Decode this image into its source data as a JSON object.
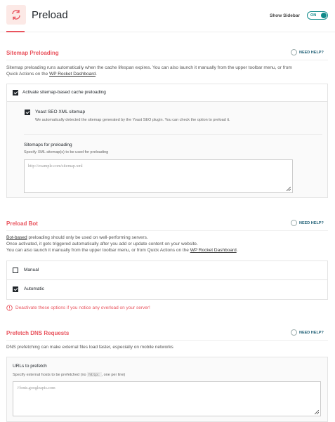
{
  "header": {
    "title": "Preload",
    "show_sidebar_label": "Show Sidebar",
    "toggle_state": "ON"
  },
  "sitemap": {
    "title": "Sitemap Preloading",
    "need_help": "NEED HELP?",
    "desc1": "Sitemap preloading runs automatically when the cache lifespan expires. You can also launch it manually from the upper toolbar menu, or from",
    "desc2_pre": "Quick Actions on the ",
    "desc2_link": "WP Rocket Dashboard",
    "desc2_post": ".",
    "activate_label": "Activate sitemap-based cache preloading",
    "yoast_label": "Yoast SEO XML sitemap",
    "yoast_desc": "We automatically detected the sitemap generated by the Yoast SEO plugin. You can check the option to preload it.",
    "sitemaps_label": "Sitemaps for preloading",
    "sitemaps_desc": "Specify XML sitemap(s) to be used for preloading",
    "sitemaps_placeholder": "http://example.com/sitemap.xml"
  },
  "bot": {
    "title": "Preload Bot",
    "need_help": "NEED HELP?",
    "desc1_link": "Bot-based",
    "desc1_post": " preloading should only be used on well-performing servers.",
    "desc2": "Once activated, it gets triggered automatically after you add or update content on your website.",
    "desc3_pre": "You can also launch it manually from the upper toolbar menu, or from Quick Actions on the ",
    "desc3_link": "WP Rocket Dashboard",
    "desc3_post": ".",
    "manual_label": "Manual",
    "automatic_label": "Automatic",
    "warning": "Deactivate these options if you notice any overload on your server!"
  },
  "dns": {
    "title": "Prefetch DNS Requests",
    "need_help": "NEED HELP?",
    "desc": "DNS prefetching can make external files load faster, especially on mobile networks",
    "urls_label": "URLs to prefetch",
    "urls_desc_pre": "Specify external hosts to be prefetched (no ",
    "urls_desc_code": "http:",
    "urls_desc_post": ", one per line)",
    "urls_placeholder": "//fonts.googleapis.com"
  },
  "colors": {
    "accent": "#e9545e",
    "toggle": "#0f8a8a"
  }
}
